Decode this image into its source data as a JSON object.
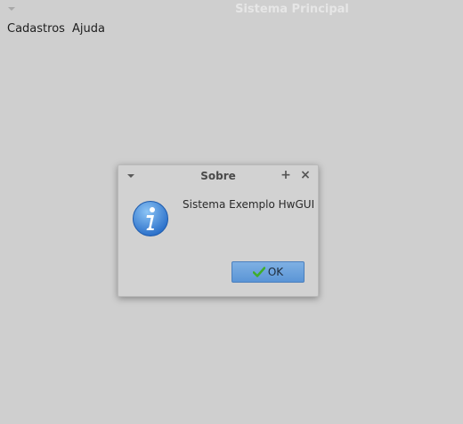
{
  "window": {
    "title": "Sistema Principal",
    "menu_icon": "chevron-down-icon"
  },
  "menubar": {
    "items": [
      {
        "label": "Cadastros"
      },
      {
        "label": "Ajuda"
      }
    ]
  },
  "dialog": {
    "title": "Sobre",
    "menu_icon": "chevron-down-icon",
    "maximize_icon": "plus-icon",
    "close_icon": "close-icon",
    "icon": "info-icon",
    "message": "Sistema Exemplo HwGUI",
    "ok_label": "OK",
    "ok_icon": "checkmark-icon"
  },
  "colors": {
    "background": "#cfcfcf",
    "button_accent": "#5b95d6",
    "info_blue": "#2f78d0",
    "check_green": "#3fae2a"
  }
}
